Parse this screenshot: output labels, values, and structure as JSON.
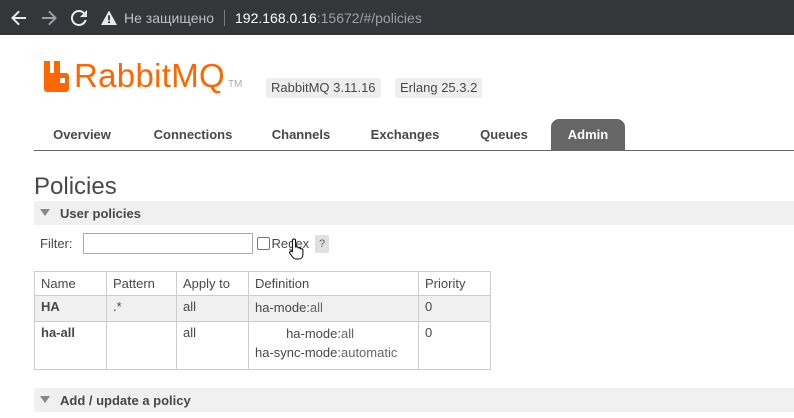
{
  "browser": {
    "not_secure_label": "Не защищено",
    "url_host": "192.168.0.16",
    "url_rest": ":15672/#/policies"
  },
  "header": {
    "brand": "RabbitMQ",
    "tm": "TM",
    "rabbitmq_version": "RabbitMQ 3.11.16",
    "erlang_version": "Erlang 25.3.2",
    "brand_color": "#ff6600"
  },
  "tabs": [
    {
      "label": "Overview",
      "active": false
    },
    {
      "label": "Connections",
      "active": false
    },
    {
      "label": "Channels",
      "active": false
    },
    {
      "label": "Exchanges",
      "active": false
    },
    {
      "label": "Queues",
      "active": false
    },
    {
      "label": "Admin",
      "active": true
    }
  ],
  "page": {
    "title": "Policies",
    "user_policies_section": "User policies",
    "add_policy_section": "Add / update a policy"
  },
  "filter": {
    "label": "Filter:",
    "value": "",
    "regex_label": "Regex",
    "help": "?"
  },
  "table": {
    "columns": [
      "Name",
      "Pattern",
      "Apply to",
      "Definition",
      "Priority"
    ],
    "rows": [
      {
        "name": "HA",
        "pattern": ".*",
        "apply_to": "all",
        "definition": [
          {
            "key": "ha-mode:",
            "value": "all"
          }
        ],
        "priority": "0"
      },
      {
        "name": "ha-all",
        "pattern": "",
        "apply_to": "all",
        "definition": [
          {
            "key": "ha-mode:",
            "value": "all"
          },
          {
            "key": "ha-sync-mode:",
            "value": "automatic"
          }
        ],
        "priority": "0"
      }
    ]
  }
}
